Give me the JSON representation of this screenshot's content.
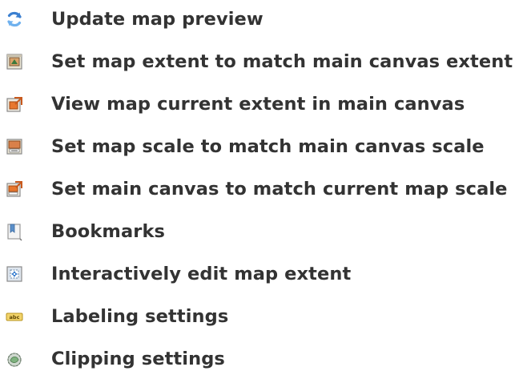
{
  "toolbar_items": [
    {
      "label": "Update map preview",
      "icon": "refresh-icon"
    },
    {
      "label": "Set map extent to match main canvas extent",
      "icon": "set-extent-icon"
    },
    {
      "label": "View map current extent in main canvas",
      "icon": "view-extent-icon"
    },
    {
      "label": "Set map scale to match main canvas scale",
      "icon": "set-scale-icon"
    },
    {
      "label": "Set main canvas to match current map scale",
      "icon": "set-canvas-scale-icon"
    },
    {
      "label": "Bookmarks",
      "icon": "bookmarks-icon"
    },
    {
      "label": "Interactively edit map extent",
      "icon": "edit-extent-icon"
    },
    {
      "label": "Labeling settings",
      "icon": "labeling-icon"
    },
    {
      "label": "Clipping settings",
      "icon": "clipping-icon"
    }
  ],
  "colors": {
    "text": "#333333",
    "accent_blue": "#4a90d9",
    "accent_orange": "#e8772e"
  }
}
